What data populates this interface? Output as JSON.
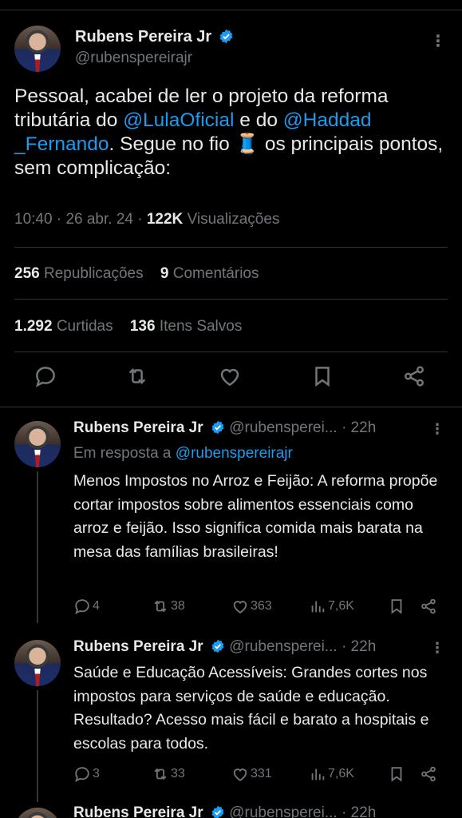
{
  "main_tweet": {
    "author_name": "Rubens Pereira Jr",
    "author_handle": "@rubenspereirajr",
    "text_parts": {
      "p1": "Pessoal, acabei de ler o projeto da reforma tributária do ",
      "mention1": "@LulaOficial",
      "p2": " e do ",
      "mention2": "@Haddad _Fernando",
      "p3": ". Segue no fio 🧵 os principais pontos, sem complicação:"
    },
    "time": "10:40",
    "date": "26 abr. 24",
    "views_count": "122K",
    "views_label": "Visualizações",
    "reposts_count": "256",
    "reposts_label": "Republicações",
    "comments_count": "9",
    "comments_label": "Comentários",
    "likes_count": "1.292",
    "likes_label": "Curtidas",
    "saves_count": "136",
    "saves_label": "Itens Salvos"
  },
  "replies": [
    {
      "author_name": "Rubens Pereira Jr",
      "author_handle": "@rubenspereі...",
      "time": "· 22h",
      "in_reply_prefix": "Em resposta a ",
      "in_reply_handle": "@rubenspereirajr",
      "text": "Menos Impostos no Arroz e Feijão: A reforma propõe cortar impostos sobre alimentos essenciais como arroz e feijão. Isso significa comida mais barata na mesa das famílias brasileiras!",
      "comments": "4",
      "reposts": "38",
      "likes": "363",
      "views": "7,6K"
    },
    {
      "author_name": "Rubens Pereira Jr",
      "author_handle": "@rubenspereі...",
      "time": "· 22h",
      "text": "Saúde e Educação Acessíveis: Grandes cortes nos impostos para serviços de saúde e educação. Resultado? Acesso mais fácil e barato a hospitais e escolas para todos.",
      "comments": "3",
      "reposts": "33",
      "likes": "331",
      "views": "7,6K"
    },
    {
      "author_name": "Rubens Pereira Jr",
      "author_handle": "@rubenspereі...",
      "time": "· 22h"
    }
  ],
  "colors": {
    "background": "#000000",
    "text": "#e7e9ea",
    "secondary": "#71767b",
    "link": "#1d9bf0",
    "divider": "#2f3336"
  }
}
